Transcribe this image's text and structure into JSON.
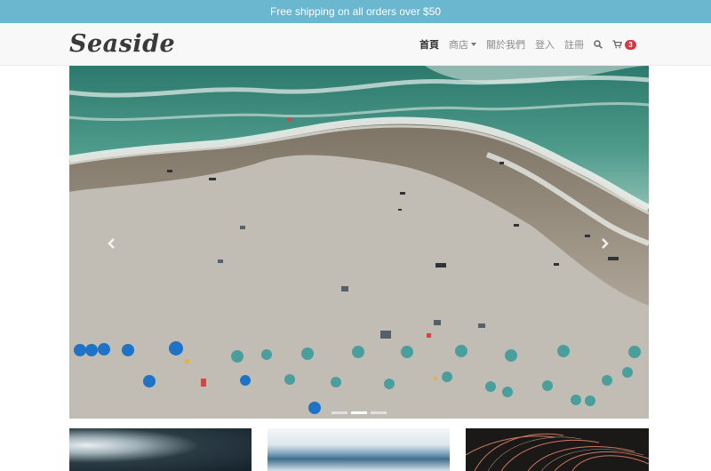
{
  "promo": {
    "text": "Free shipping on all orders over $50"
  },
  "brand": {
    "name": "Seaside"
  },
  "nav": {
    "items": [
      {
        "label": "首頁",
        "active": true
      },
      {
        "label": "商店",
        "dropdown": true
      },
      {
        "label": "關於我們"
      },
      {
        "label": "登入"
      },
      {
        "label": "註冊"
      }
    ],
    "search_icon": "search-icon",
    "cart_icon": "shopping-cart-icon",
    "cart_count": "3"
  },
  "carousel": {
    "slide_count": 3,
    "active_slide": 2,
    "prev_icon": "chevron-left-icon",
    "next_icon": "chevron-right-icon"
  },
  "colors": {
    "promo_bg": "#6ab7cf",
    "navbar_bg": "#f8f8f9",
    "badge": "#dc3545",
    "umbrella_blue": "#1f78c8",
    "umbrella_teal": "#4aa5a3",
    "sea": "#2f7f72"
  }
}
